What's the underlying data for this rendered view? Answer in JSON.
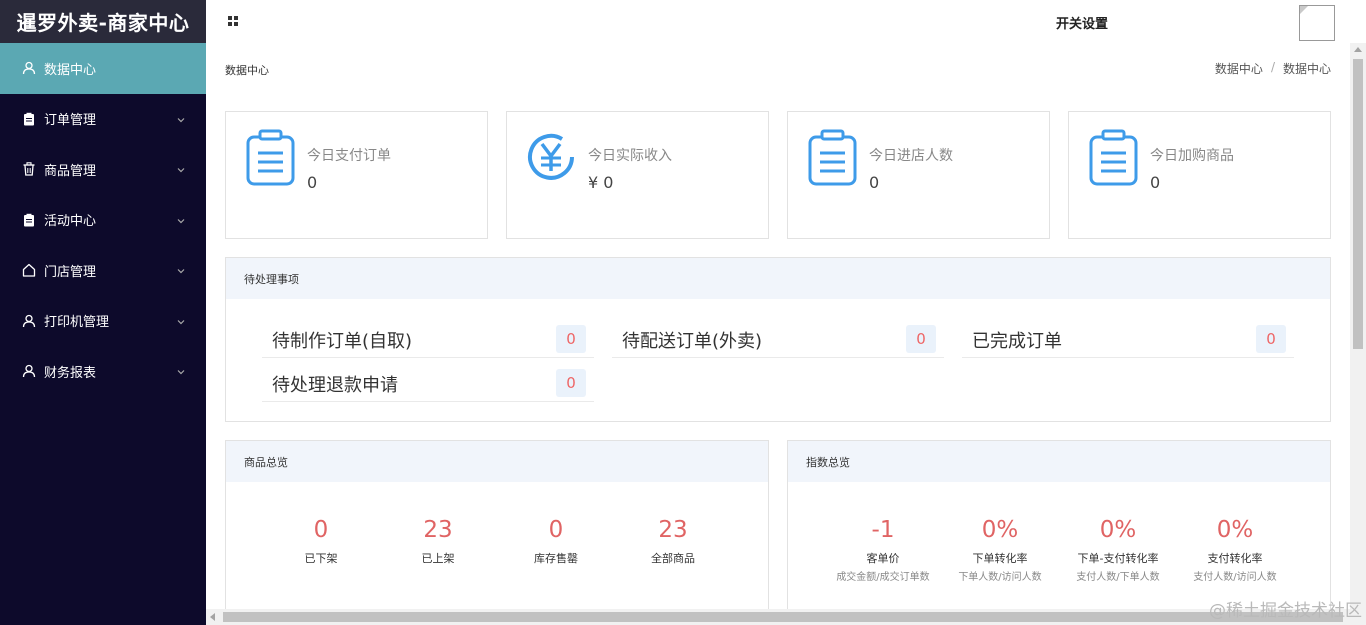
{
  "app": {
    "title": "暹罗外卖-商家中心"
  },
  "sidebar": {
    "items": [
      {
        "label": "数据中心",
        "icon": "user-icon",
        "active": true
      },
      {
        "label": "订单管理",
        "icon": "clipboard-icon"
      },
      {
        "label": "商品管理",
        "icon": "trash-icon"
      },
      {
        "label": "活动中心",
        "icon": "clipboard-icon"
      },
      {
        "label": "门店管理",
        "icon": "home-icon"
      },
      {
        "label": "打印机管理",
        "icon": "user-icon"
      },
      {
        "label": "财务报表",
        "icon": "user-icon"
      }
    ]
  },
  "topbar": {
    "settings_label": "开关设置"
  },
  "page": {
    "title": "数据中心",
    "breadcrumb": [
      "数据中心",
      "/",
      "数据中心"
    ]
  },
  "stats": [
    {
      "label": "今日支付订单",
      "value": "0",
      "icon": "clipboard-icon"
    },
    {
      "label": "今日实际收入",
      "value": "¥ 0",
      "icon": "yuan-icon"
    },
    {
      "label": "今日进店人数",
      "value": "0",
      "icon": "clipboard-icon"
    },
    {
      "label": "今日加购商品",
      "value": "0",
      "icon": "clipboard-icon"
    }
  ],
  "todo": {
    "title": "待处理事项",
    "items": [
      {
        "label": "待制作订单(自取)",
        "count": "0"
      },
      {
        "label": "待配送订单(外卖)",
        "count": "0"
      },
      {
        "label": "已完成订单",
        "count": "0"
      },
      {
        "label": "待处理退款申请",
        "count": "0"
      }
    ]
  },
  "goods": {
    "title": "商品总览",
    "metrics": [
      {
        "value": "0",
        "label": "已下架"
      },
      {
        "value": "23",
        "label": "已上架"
      },
      {
        "value": "0",
        "label": "库存售罄"
      },
      {
        "value": "23",
        "label": "全部商品"
      }
    ]
  },
  "index": {
    "title": "指数总览",
    "metrics": [
      {
        "value": "-1",
        "label": "客单价",
        "sub": "成交金额/成交订单数"
      },
      {
        "value": "0%",
        "label": "下单转化率",
        "sub": "下单人数/访问人数"
      },
      {
        "value": "0%",
        "label": "下单-支付转化率",
        "sub": "支付人数/下单人数"
      },
      {
        "value": "0%",
        "label": "支付转化率",
        "sub": "支付人数/访问人数"
      }
    ]
  },
  "watermark": "@稀土掘金技术社区",
  "colors": {
    "sidebar_bg": "#0d0a2b",
    "active": "#5ba8b3",
    "accent_blue": "#3e9be9",
    "value_red": "#e06464"
  }
}
